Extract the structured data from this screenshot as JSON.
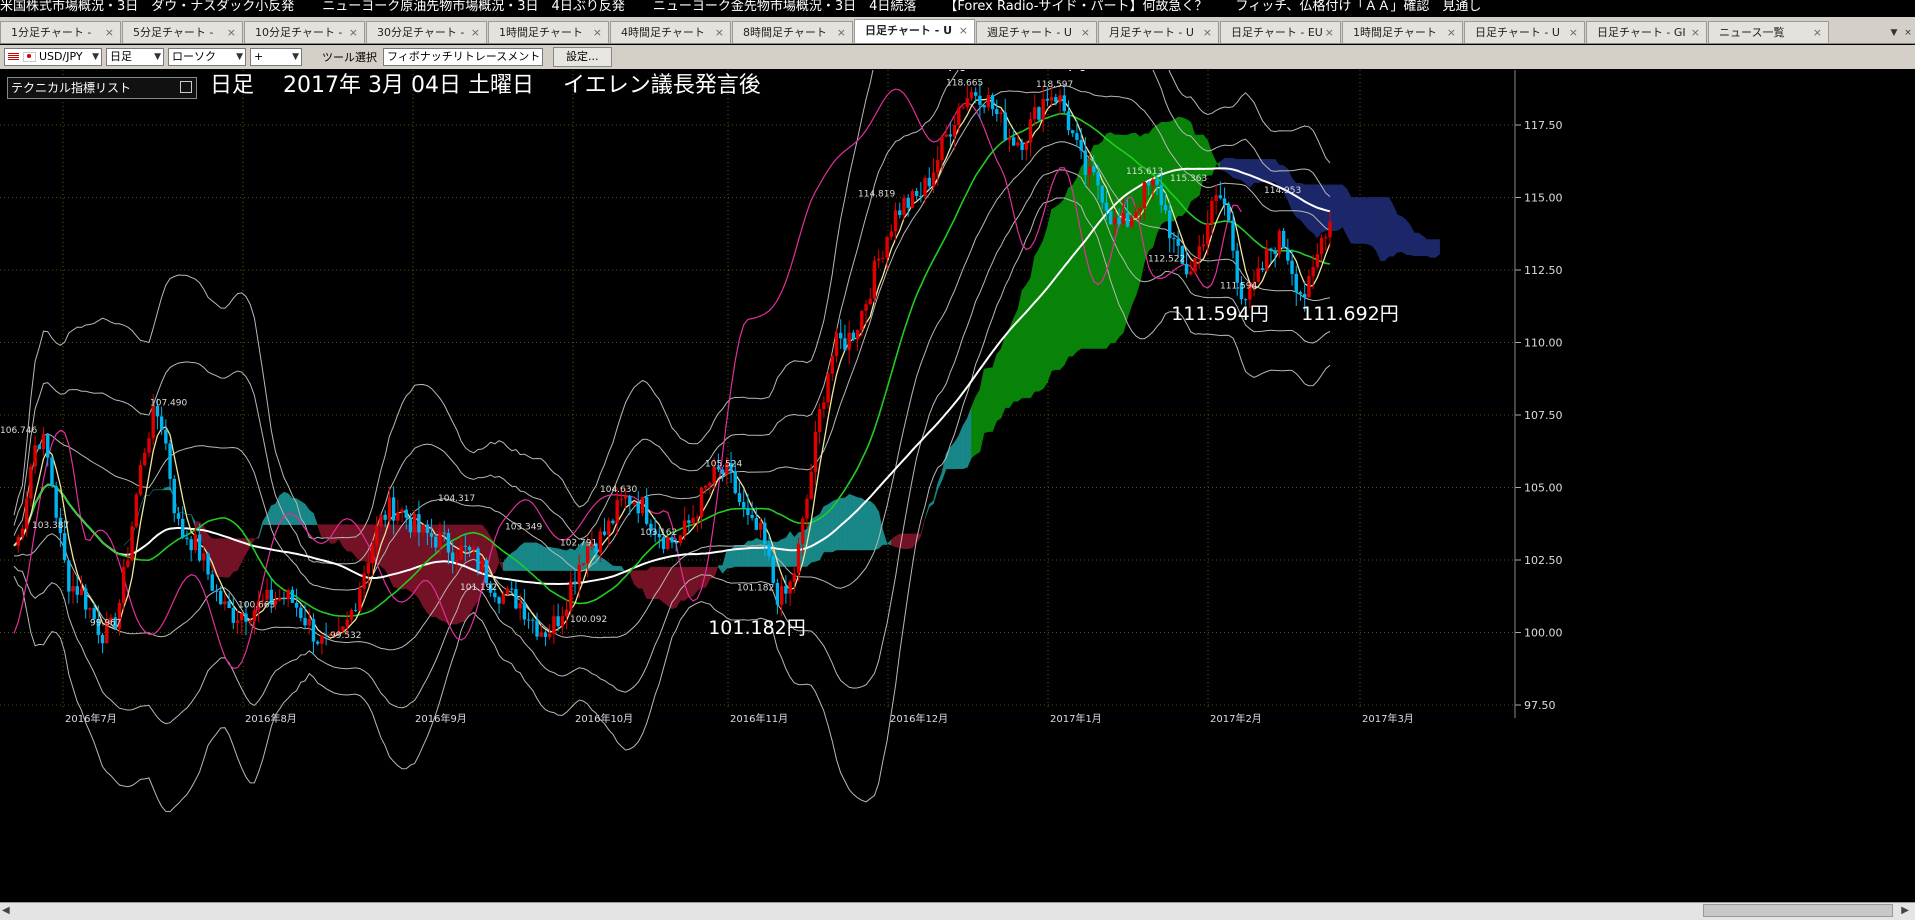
{
  "news_ticker": [
    "米国株式市場概況・3日　ダウ・ナスダック小反発",
    "ニューヨーク原油先物市場概況・3日　4日ぶり反発",
    "ニューヨーク金先物市場概況・3日　4日続落",
    "【Forex Radio-サイド・パート】何故急く？",
    "フィッチ、仏格付け「ＡＡ」確認　見通し"
  ],
  "tabs": [
    {
      "label": "1分足チャート -",
      "active": false
    },
    {
      "label": "5分足チャート -",
      "active": false
    },
    {
      "label": "10分足チャート -",
      "active": false
    },
    {
      "label": "30分足チャート -",
      "active": false
    },
    {
      "label": "1時間足チャート",
      "active": false
    },
    {
      "label": "4時間足チャート",
      "active": false
    },
    {
      "label": "8時間足チャート",
      "active": false
    },
    {
      "label": "日足チャート - U",
      "active": true
    },
    {
      "label": "週足チャート - U",
      "active": false
    },
    {
      "label": "月足チャート - U",
      "active": false
    },
    {
      "label": "日足チャート - EU",
      "active": false
    },
    {
      "label": "1時間足チャート",
      "active": false
    },
    {
      "label": "日足チャート - U",
      "active": false
    },
    {
      "label": "日足チャート - GI",
      "active": false
    },
    {
      "label": "ニュース一覧",
      "active": false
    }
  ],
  "toolbar": {
    "pair": "USD/JPY",
    "timeframe": "日足",
    "chart_style": "ローソク",
    "cursor_mode": "+",
    "tool_label": "ツール選択",
    "tool_value": "フィボナッチリトレースメント",
    "settings_label": "設定..."
  },
  "indicator_list_label": "テクニカル指標リスト",
  "chart_data": {
    "type": "candlestick",
    "title": "日足　 2017年 3月 04日 土曜日　 イエレン議長発言後",
    "y_ticks": [
      "117.50",
      "115.00",
      "112.50",
      "110.00",
      "107.50",
      "105.00",
      "102.50",
      "100.00",
      "97.50"
    ],
    "ylim": [
      97.5,
      119.5
    ],
    "x_ticks": [
      "2016年7月",
      "2016年8月",
      "2016年9月",
      "2016年10月",
      "2016年11月",
      "2016年12月",
      "2017年1月",
      "2017年2月",
      "2017年3月"
    ],
    "point_labels": [
      "106.746",
      "107.490",
      "103.387",
      "99.967",
      "100.663",
      "99.532",
      "104.317",
      "103.349",
      "102.791",
      "101.192",
      "100.092",
      "104.630",
      "103.162",
      "105.524",
      "101.182",
      "114.819",
      "118.665",
      "118.597",
      "115.613",
      "115.363",
      "114.953",
      "112.522",
      "111.594"
    ],
    "callouts": [
      "118.665円",
      "118.597円",
      "111.594円",
      "111.692円",
      "101.182円"
    ],
    "colors": {
      "up": "#e00000",
      "down": "#00b4f0",
      "kumo_up": "#0a8a0a",
      "kumo_down": "#7a1428",
      "kumo_span": "#1a8e8e",
      "kumo_blue": "#1e2a70",
      "ma_long": "#ffffff",
      "ma_mid": "#22cc22",
      "ma_short": "#f0e6a0",
      "rsi": "#e0309a",
      "band": "#b8b8b8",
      "grid": "#c8c820"
    }
  }
}
